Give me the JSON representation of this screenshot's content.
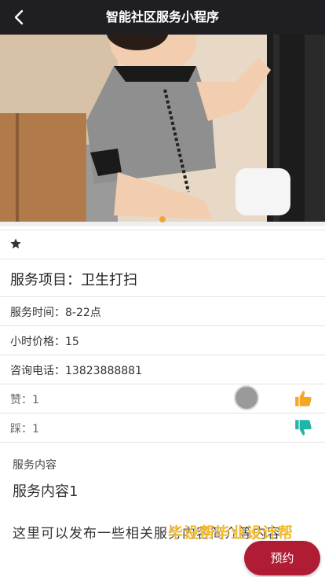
{
  "header": {
    "title": "智能社区服务小程序"
  },
  "service": {
    "name": "服务项目：卫生打扫",
    "time": "服务时间：8-22点",
    "price": "小时价格：15",
    "phone": "咨询电话：13823888881",
    "likes": "赞：1",
    "dislikes": "踩：1"
  },
  "content": {
    "label": "服务内容",
    "title": "服务内容1",
    "description": "这里可以发布一些相关服务内容简介等内容"
  },
  "watermark": "毕设帮毕业设计帮",
  "actions": {
    "book_label": "预约"
  },
  "colors": {
    "nav_bg": "#1f1f23",
    "accent": "#b01c34",
    "like": "#f5a623",
    "dislike": "#1fb5a8",
    "dot": "#f1a33a"
  },
  "icons": [
    "back-icon",
    "star-icon",
    "thumbs-up-icon",
    "thumbs-down-icon"
  ]
}
